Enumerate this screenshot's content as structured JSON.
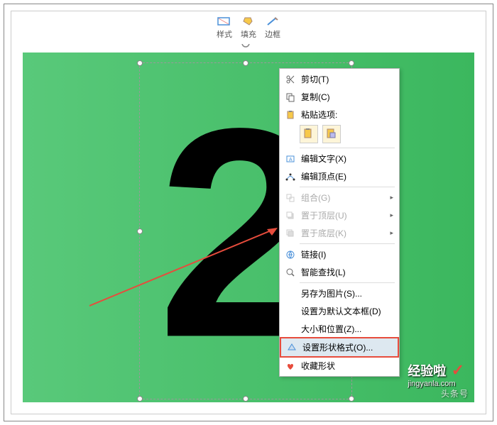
{
  "toolbar": {
    "style": "样式",
    "fill": "填充",
    "border": "边框"
  },
  "canvas": {
    "number": "2"
  },
  "menu": {
    "cut": "剪切(T)",
    "copy": "复制(C)",
    "paste_options": "粘贴选项:",
    "edit_text": "编辑文字(X)",
    "edit_points": "编辑顶点(E)",
    "group": "组合(G)",
    "bring_front": "置于顶层(U)",
    "send_back": "置于底层(K)",
    "link": "链接(I)",
    "smart_lookup": "智能查找(L)",
    "save_as_picture": "另存为图片(S)...",
    "set_default_textbox": "设置为默认文本框(D)",
    "size_position": "大小和位置(Z)...",
    "format_shape": "设置形状格式(O)...",
    "favorite_shape": "收藏形状"
  },
  "watermark": {
    "brand": "经验啦",
    "url": "jingyanla.com",
    "source": "头条号"
  }
}
